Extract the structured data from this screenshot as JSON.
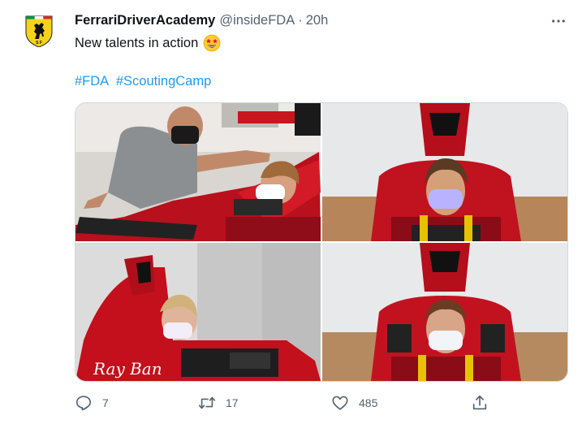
{
  "tweet": {
    "display_name": "FerrariDriverAcademy",
    "handle": "@insideFDA",
    "separator": "·",
    "time": "20h",
    "text": "New talents in action",
    "emoji": "star-struck-emoji",
    "hashtags": [
      "#FDA",
      "#ScoutingCamp"
    ],
    "avatar_icon": "ferrari-prancing-horse-logo",
    "more_icon": "more-horizontal-icon"
  },
  "media": {
    "photos": [
      {
        "name": "photo-instructor-and-driver-at-simulator"
      },
      {
        "name": "photo-driver-in-cockpit-front-view"
      },
      {
        "name": "photo-driver-in-car-side-view"
      },
      {
        "name": "photo-driver-in-cockpit-front-view-2"
      }
    ]
  },
  "actions": {
    "reply_count": "7",
    "retweet_count": "17",
    "like_count": "485",
    "reply_icon": "reply-icon",
    "retweet_icon": "retweet-icon",
    "like_icon": "heart-icon",
    "share_icon": "share-icon"
  },
  "colors": {
    "accent": "#1d9bf0",
    "ferrari_red": "#c8102e",
    "ferrari_yellow": "#f6d21a",
    "muted": "#536471"
  }
}
